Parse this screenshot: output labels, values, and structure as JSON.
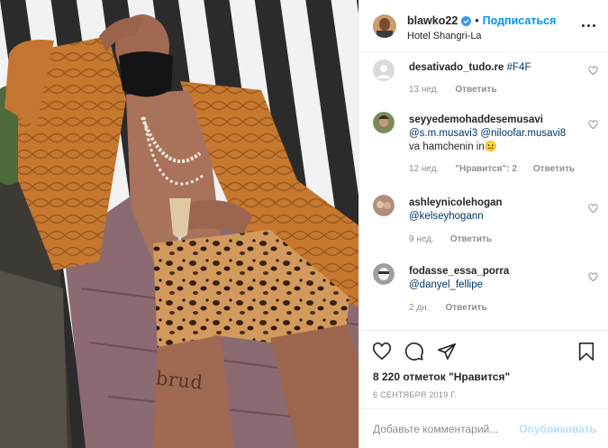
{
  "photo": {
    "shorts_text": "brud"
  },
  "header": {
    "username": "blawko22",
    "separator": "•",
    "follow_label": "Подписаться",
    "location": "Hotel Shangri-La",
    "verified_icon": "verified-badge-icon",
    "more_icon": "more-options-icon"
  },
  "comments": [
    {
      "username": "desativado_tudo.re",
      "text": "#F4F",
      "time": "13 нед.",
      "likes": "",
      "reply": "Ответить",
      "avatar_color": "#dcdcdc"
    },
    {
      "username": "seyyedemohaddesemusavi",
      "mention1": "@s.m.musavi3",
      "mention2": "@niloofar.musavi8",
      "text": "va hamchenin in",
      "emoji": "😐",
      "time": "12 нед.",
      "likes": "\"Нравится\": 2",
      "reply": "Ответить",
      "avatar_color": "#7a8a5a"
    },
    {
      "username": "ashleynicolehogan",
      "mention1": "@kelseyhogann",
      "time": "9 нед.",
      "reply": "Ответить",
      "avatar_color": "#b08e7a"
    },
    {
      "username": "fodasse_essa_porra",
      "mention1": "@danyel_fellipe",
      "time": "2 дн.",
      "reply": "Ответить",
      "avatar_color": "#9aa0a0"
    }
  ],
  "actions": {
    "like_icon": "heart-icon",
    "comment_icon": "comment-icon",
    "share_icon": "share-icon",
    "save_icon": "bookmark-icon",
    "likes_total": "8 220 отметок \"Нравится\"",
    "date": "6 СЕНТЯБРЯ 2019 Г."
  },
  "add_comment": {
    "placeholder": "Добавьте комментарий...",
    "publish_label": "Опубликовать"
  },
  "colors": {
    "accent": "#0095f6",
    "link": "#00376b",
    "muted": "#8e8e8e",
    "publish_disabled": "#b2dffc"
  }
}
